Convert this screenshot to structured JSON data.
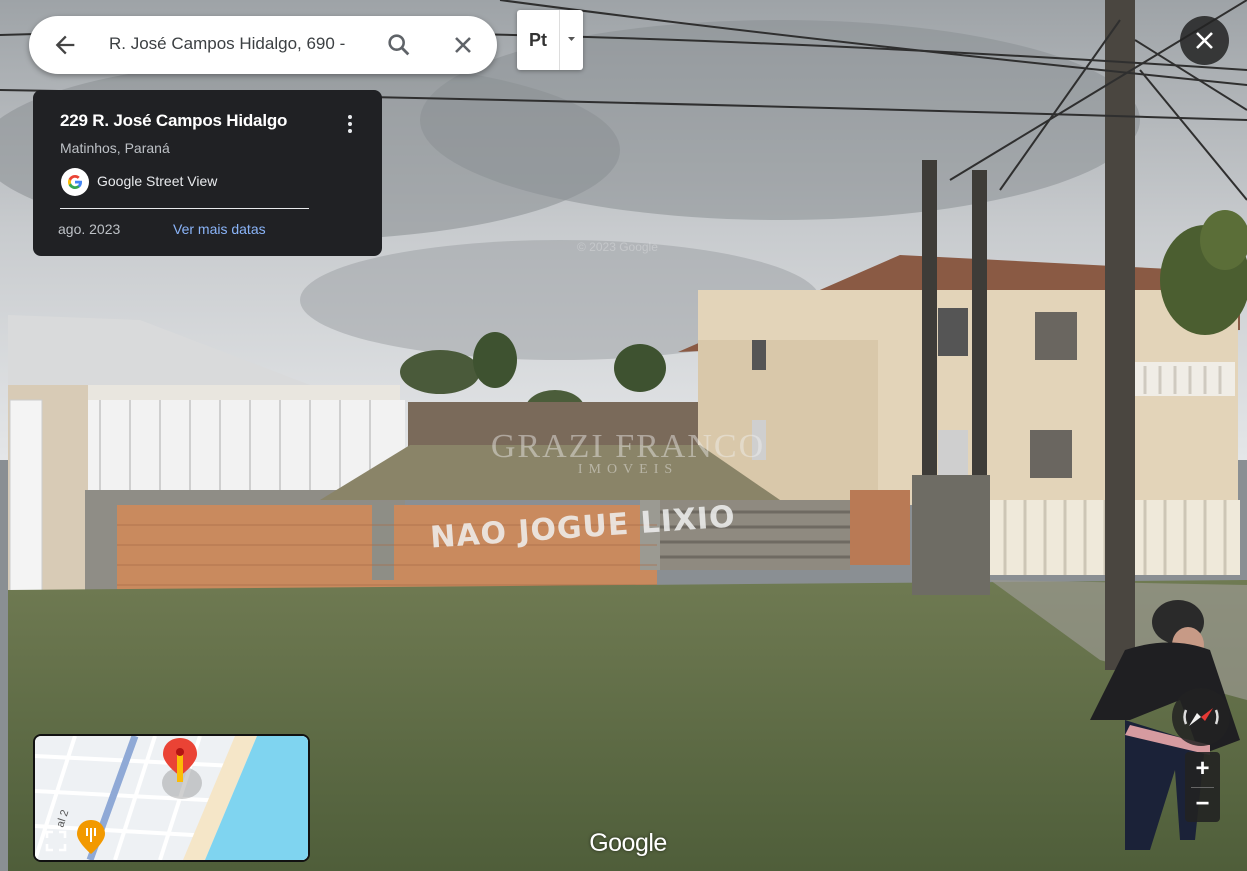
{
  "search": {
    "query": "R. José Campos Hidalgo, 690 -"
  },
  "language_menu": {
    "selected": "Pt"
  },
  "info_card": {
    "title": "229 R. José Campos Hidalgo",
    "subtitle": "Matinhos, Paraná",
    "provider": "Google Street View",
    "date": "ago. 2023",
    "more_dates_label": "Ver mais datas"
  },
  "scene": {
    "watermark_main": "GRAZI FRANCO",
    "watermark_sub": "IMOVEIS",
    "graffiti": "NAO JOGUE LIXIO",
    "copyright": "© 2023 Google"
  },
  "minimap": {
    "street_label": "al 2"
  },
  "zoom": {
    "in_label": "+",
    "out_label": "−"
  },
  "footer": {
    "wordmark": "Google"
  },
  "colors": {
    "card_bg": "#202124",
    "link": "#8ab4f8",
    "pin": "#ea4335",
    "water": "#7fd4f0",
    "beach": "#f5e6c8"
  },
  "icons": {
    "back": "arrow-left-icon",
    "search": "search-icon",
    "clear": "close-icon",
    "dropdown": "caret-down-icon",
    "close_streetview": "close-icon",
    "more": "more-vertical-icon",
    "google": "google-g-icon",
    "pin": "map-pin-icon",
    "restaurant": "restaurant-icon",
    "expand": "expand-icon",
    "compass": "compass-icon"
  }
}
